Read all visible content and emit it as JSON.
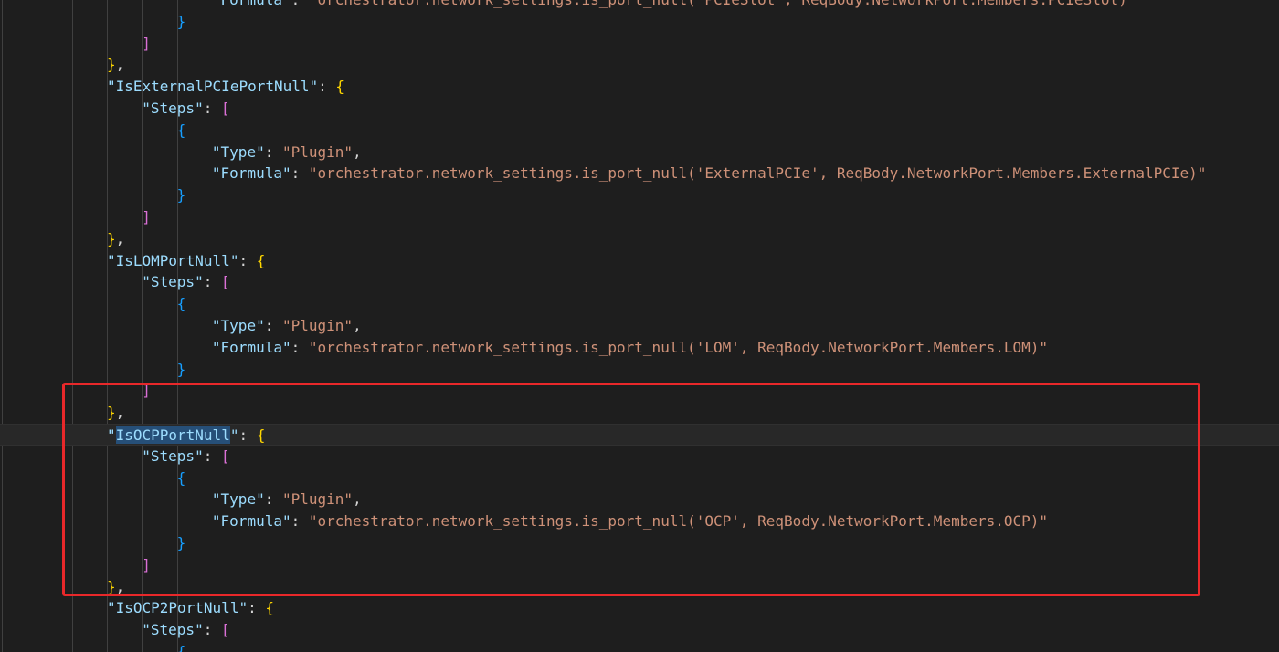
{
  "editor": {
    "lines": [
      {
        "indent": 6,
        "tokens": [
          {
            "t": "\"Formula\"",
            "c": "k"
          },
          {
            "t": ": ",
            "c": "p"
          },
          {
            "t": "\"orchestrator.network_settings.is_port_null('PCIeSlot', ReqBody.NetworkPort.Members.PCIeSlot)\"",
            "c": "s"
          }
        ]
      },
      {
        "indent": 5,
        "tokens": [
          {
            "t": "}",
            "c": "b3"
          }
        ]
      },
      {
        "indent": 4,
        "tokens": [
          {
            "t": "]",
            "c": "b2"
          }
        ]
      },
      {
        "indent": 3,
        "tokens": [
          {
            "t": "}",
            "c": "b1"
          },
          {
            "t": ",",
            "c": "p"
          }
        ]
      },
      {
        "indent": 3,
        "tokens": [
          {
            "t": "\"IsExternalPCIePortNull\"",
            "c": "k"
          },
          {
            "t": ": ",
            "c": "p"
          },
          {
            "t": "{",
            "c": "b1"
          }
        ]
      },
      {
        "indent": 4,
        "tokens": [
          {
            "t": "\"Steps\"",
            "c": "k"
          },
          {
            "t": ": ",
            "c": "p"
          },
          {
            "t": "[",
            "c": "b2"
          }
        ]
      },
      {
        "indent": 5,
        "tokens": [
          {
            "t": "{",
            "c": "b3"
          }
        ]
      },
      {
        "indent": 6,
        "tokens": [
          {
            "t": "\"Type\"",
            "c": "k"
          },
          {
            "t": ": ",
            "c": "p"
          },
          {
            "t": "\"Plugin\"",
            "c": "s"
          },
          {
            "t": ",",
            "c": "p"
          }
        ]
      },
      {
        "indent": 6,
        "tokens": [
          {
            "t": "\"Formula\"",
            "c": "k"
          },
          {
            "t": ": ",
            "c": "p"
          },
          {
            "t": "\"orchestrator.network_settings.is_port_null('ExternalPCIe', ReqBody.NetworkPort.Members.ExternalPCIe)\"",
            "c": "s"
          }
        ]
      },
      {
        "indent": 5,
        "tokens": [
          {
            "t": "}",
            "c": "b3"
          }
        ]
      },
      {
        "indent": 4,
        "tokens": [
          {
            "t": "]",
            "c": "b2"
          }
        ]
      },
      {
        "indent": 3,
        "tokens": [
          {
            "t": "}",
            "c": "b1"
          },
          {
            "t": ",",
            "c": "p"
          }
        ]
      },
      {
        "indent": 3,
        "tokens": [
          {
            "t": "\"IsLOMPortNull\"",
            "c": "k"
          },
          {
            "t": ": ",
            "c": "p"
          },
          {
            "t": "{",
            "c": "b1"
          }
        ]
      },
      {
        "indent": 4,
        "tokens": [
          {
            "t": "\"Steps\"",
            "c": "k"
          },
          {
            "t": ": ",
            "c": "p"
          },
          {
            "t": "[",
            "c": "b2"
          }
        ]
      },
      {
        "indent": 5,
        "tokens": [
          {
            "t": "{",
            "c": "b3"
          }
        ]
      },
      {
        "indent": 6,
        "tokens": [
          {
            "t": "\"Type\"",
            "c": "k"
          },
          {
            "t": ": ",
            "c": "p"
          },
          {
            "t": "\"Plugin\"",
            "c": "s"
          },
          {
            "t": ",",
            "c": "p"
          }
        ]
      },
      {
        "indent": 6,
        "tokens": [
          {
            "t": "\"Formula\"",
            "c": "k"
          },
          {
            "t": ": ",
            "c": "p"
          },
          {
            "t": "\"orchestrator.network_settings.is_port_null('LOM', ReqBody.NetworkPort.Members.LOM)\"",
            "c": "s"
          }
        ]
      },
      {
        "indent": 5,
        "tokens": [
          {
            "t": "}",
            "c": "b3"
          }
        ]
      },
      {
        "indent": 4,
        "tokens": [
          {
            "t": "]",
            "c": "b2"
          }
        ]
      },
      {
        "indent": 3,
        "tokens": [
          {
            "t": "}",
            "c": "b1"
          },
          {
            "t": ",",
            "c": "p"
          }
        ]
      },
      {
        "indent": 3,
        "current": true,
        "tokens": [
          {
            "t": "\"",
            "c": "k"
          },
          {
            "t": "IsOCPPortNull",
            "c": "k",
            "sel": true
          },
          {
            "t": "\"",
            "c": "k"
          },
          {
            "t": ": ",
            "c": "p"
          },
          {
            "t": "{",
            "c": "b1"
          }
        ]
      },
      {
        "indent": 4,
        "tokens": [
          {
            "t": "\"Steps\"",
            "c": "k"
          },
          {
            "t": ": ",
            "c": "p"
          },
          {
            "t": "[",
            "c": "b2"
          }
        ]
      },
      {
        "indent": 5,
        "tokens": [
          {
            "t": "{",
            "c": "b3"
          }
        ]
      },
      {
        "indent": 6,
        "tokens": [
          {
            "t": "\"Type\"",
            "c": "k"
          },
          {
            "t": ": ",
            "c": "p"
          },
          {
            "t": "\"Plugin\"",
            "c": "s"
          },
          {
            "t": ",",
            "c": "p"
          }
        ]
      },
      {
        "indent": 6,
        "tokens": [
          {
            "t": "\"Formula\"",
            "c": "k"
          },
          {
            "t": ": ",
            "c": "p"
          },
          {
            "t": "\"orchestrator.network_settings.is_port_null('OCP', ReqBody.NetworkPort.Members.OCP)\"",
            "c": "s"
          }
        ]
      },
      {
        "indent": 5,
        "tokens": [
          {
            "t": "}",
            "c": "b3"
          }
        ]
      },
      {
        "indent": 4,
        "tokens": [
          {
            "t": "]",
            "c": "b2"
          }
        ]
      },
      {
        "indent": 3,
        "tokens": [
          {
            "t": "}",
            "c": "b1"
          },
          {
            "t": ",",
            "c": "p"
          }
        ]
      },
      {
        "indent": 3,
        "tokens": [
          {
            "t": "\"IsOCP2PortNull\"",
            "c": "k"
          },
          {
            "t": ": ",
            "c": "p"
          },
          {
            "t": "{",
            "c": "b1"
          }
        ]
      },
      {
        "indent": 4,
        "tokens": [
          {
            "t": "\"Steps\"",
            "c": "k"
          },
          {
            "t": ": ",
            "c": "p"
          },
          {
            "t": "[",
            "c": "b2"
          }
        ]
      },
      {
        "indent": 5,
        "tokens": [
          {
            "t": "{",
            "c": "b3"
          }
        ]
      }
    ]
  },
  "highlight": {
    "color": "#e8282a",
    "label": "highlighted IsOCPPortNull block"
  },
  "colors": {
    "background": "#1e1e1e",
    "key": "#9cdcfe",
    "string": "#ce9178",
    "bracket_level1": "#ffd700",
    "bracket_level2": "#da70d6",
    "bracket_level3": "#179fff",
    "selection": "#264f78"
  }
}
